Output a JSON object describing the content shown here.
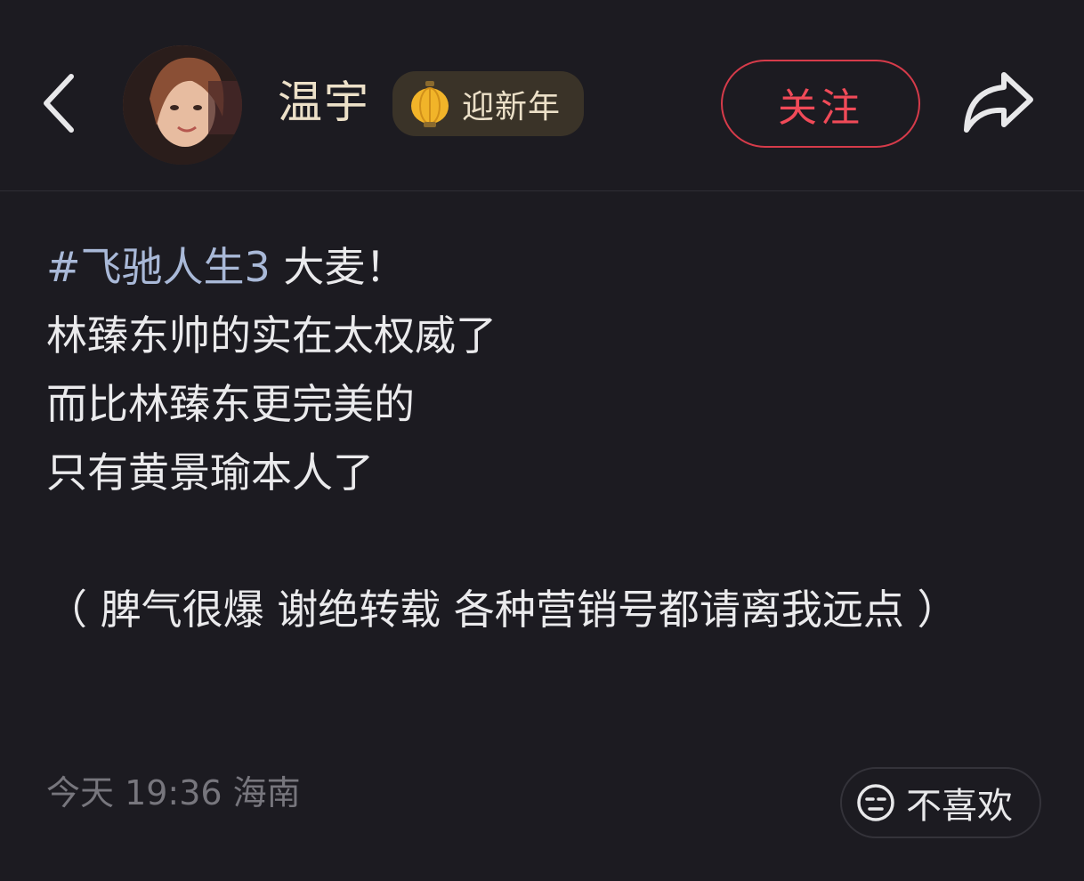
{
  "header": {
    "username": "温宇",
    "badge_label": "迎新年",
    "follow_label": "关注"
  },
  "post": {
    "hashtag": "#飞驰人生3",
    "line1_rest": " 大麦！",
    "line2": "林臻东帅的实在太权威了",
    "line3": "而比林臻东更完美的",
    "line4": "只有黄景瑜本人了",
    "note": "（ 脾气很爆 谢绝转载 各种营销号都请离我远点 ）"
  },
  "meta": {
    "time_location": "今天 19:36 海南"
  },
  "dislike": {
    "label": "不喜欢"
  },
  "colors": {
    "background": "#1c1b21",
    "accent_red": "#f04a58",
    "hashtag_blue": "#a9b9d8",
    "badge_gold": "#ece0c8"
  },
  "icons": {
    "back": "chevron-left-icon",
    "badge": "lantern-icon",
    "share": "share-arrow-icon",
    "dislike": "neutral-face-icon"
  }
}
